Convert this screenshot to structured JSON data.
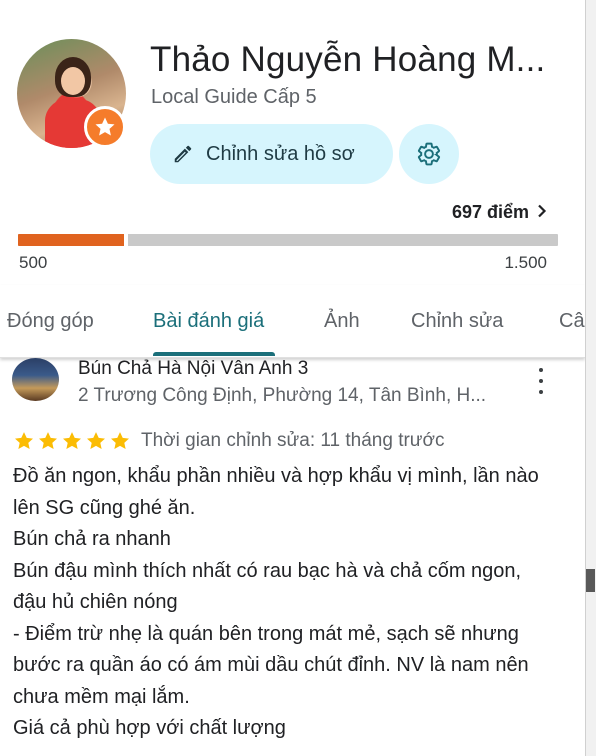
{
  "profile": {
    "name": "Thảo Nguyễn Hoàng M...",
    "level": "Local Guide Cấp 5",
    "edit_label": "Chỉnh sửa hồ sơ",
    "points": "697 điểm",
    "progress_min": "500",
    "progress_max": "1.500",
    "progress_fraction": 0.197,
    "colors": {
      "accent": "#1b6f7a",
      "button_bg": "#d6f5fd",
      "progress": "#e0631f",
      "badge": "#f57c2b"
    },
    "icons": {
      "badge": "star-icon",
      "edit": "pencil-icon",
      "settings": "gear-icon",
      "points": "chevron-right-icon"
    }
  },
  "tabs": [
    {
      "label": "Đóng góp"
    },
    {
      "label": "Bài đánh giá",
      "active": true
    },
    {
      "label": "Ảnh"
    },
    {
      "label": "Chỉnh sửa"
    },
    {
      "label": "Câu"
    }
  ],
  "review": {
    "place_name": "Bún Chả Hà Nội Vân Anh 3",
    "place_address": "2 Trương Công Định, Phường 14, Tân Bình, H...",
    "rating": 5,
    "time": "Thời gian chỉnh sửa: 11 tháng trước",
    "text": "Đồ ăn ngon, khẩu phần nhiều và hợp khẩu vị mình, lần nào lên SG cũng ghé ăn.\nBún chả ra nhanh\nBún đậu mình thích nhất có rau bạc hà và chả cốm ngon, đậu hủ chiên nóng\n- Điểm trừ nhẹ là quán bên trong mát mẻ, sạch sẽ nhưng bước ra quần áo có ám mùi dầu chút đỉnh. NV là nam nên chưa mềm mại lắm.\nGiá cả phù hợp với chất lượng",
    "star_color": "#fbbc04",
    "icons": {
      "more": "more-vert-icon"
    }
  }
}
